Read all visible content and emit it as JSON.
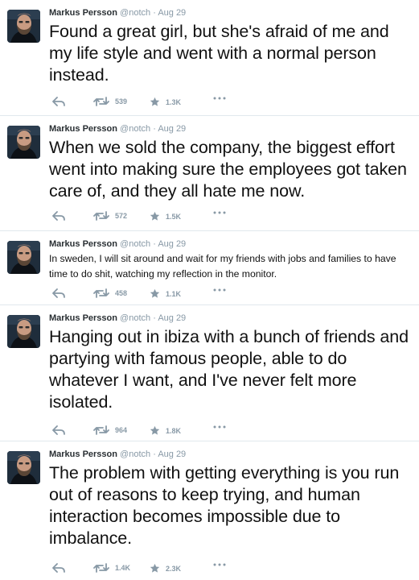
{
  "author": {
    "name": "Markus Persson",
    "handle": "@notch",
    "separator": "·"
  },
  "tweets": [
    {
      "date": "Aug 29",
      "text": "Found a great girl, but she's afraid of me and my life style and went with a normal person instead.",
      "retweets": "539",
      "favorites": "1.3K"
    },
    {
      "date": "Aug 29",
      "text": "When we sold the company, the biggest effort went into making sure the employees got taken care of, and they all hate me now.",
      "retweets": "572",
      "favorites": "1.5K"
    },
    {
      "date": "Aug 29",
      "text": "In sweden, I will sit around and wait for my friends with jobs and families to have time to do shit, watching my reflection in the monitor.",
      "retweets": "458",
      "favorites": "1.1K"
    },
    {
      "date": "Aug 29",
      "text": "Hanging out in ibiza with a bunch of friends and partying with famous people, able to do whatever I want, and I've never felt more isolated.",
      "retweets": "964",
      "favorites": "1.8K"
    },
    {
      "date": "Aug 29",
      "text": "The problem with getting everything is you run out of reasons to keep trying, and human interaction becomes impossible due to imbalance.",
      "retweets": "1.4K",
      "favorites": "2.3K"
    }
  ],
  "icons": {
    "reply": "reply-icon",
    "retweet": "retweet-icon",
    "favorite": "star-icon",
    "more": "more-dots-icon"
  },
  "colors": {
    "meta": "#8899a6",
    "divider": "#e1e8ed",
    "text": "#111111",
    "name": "#292f33"
  }
}
